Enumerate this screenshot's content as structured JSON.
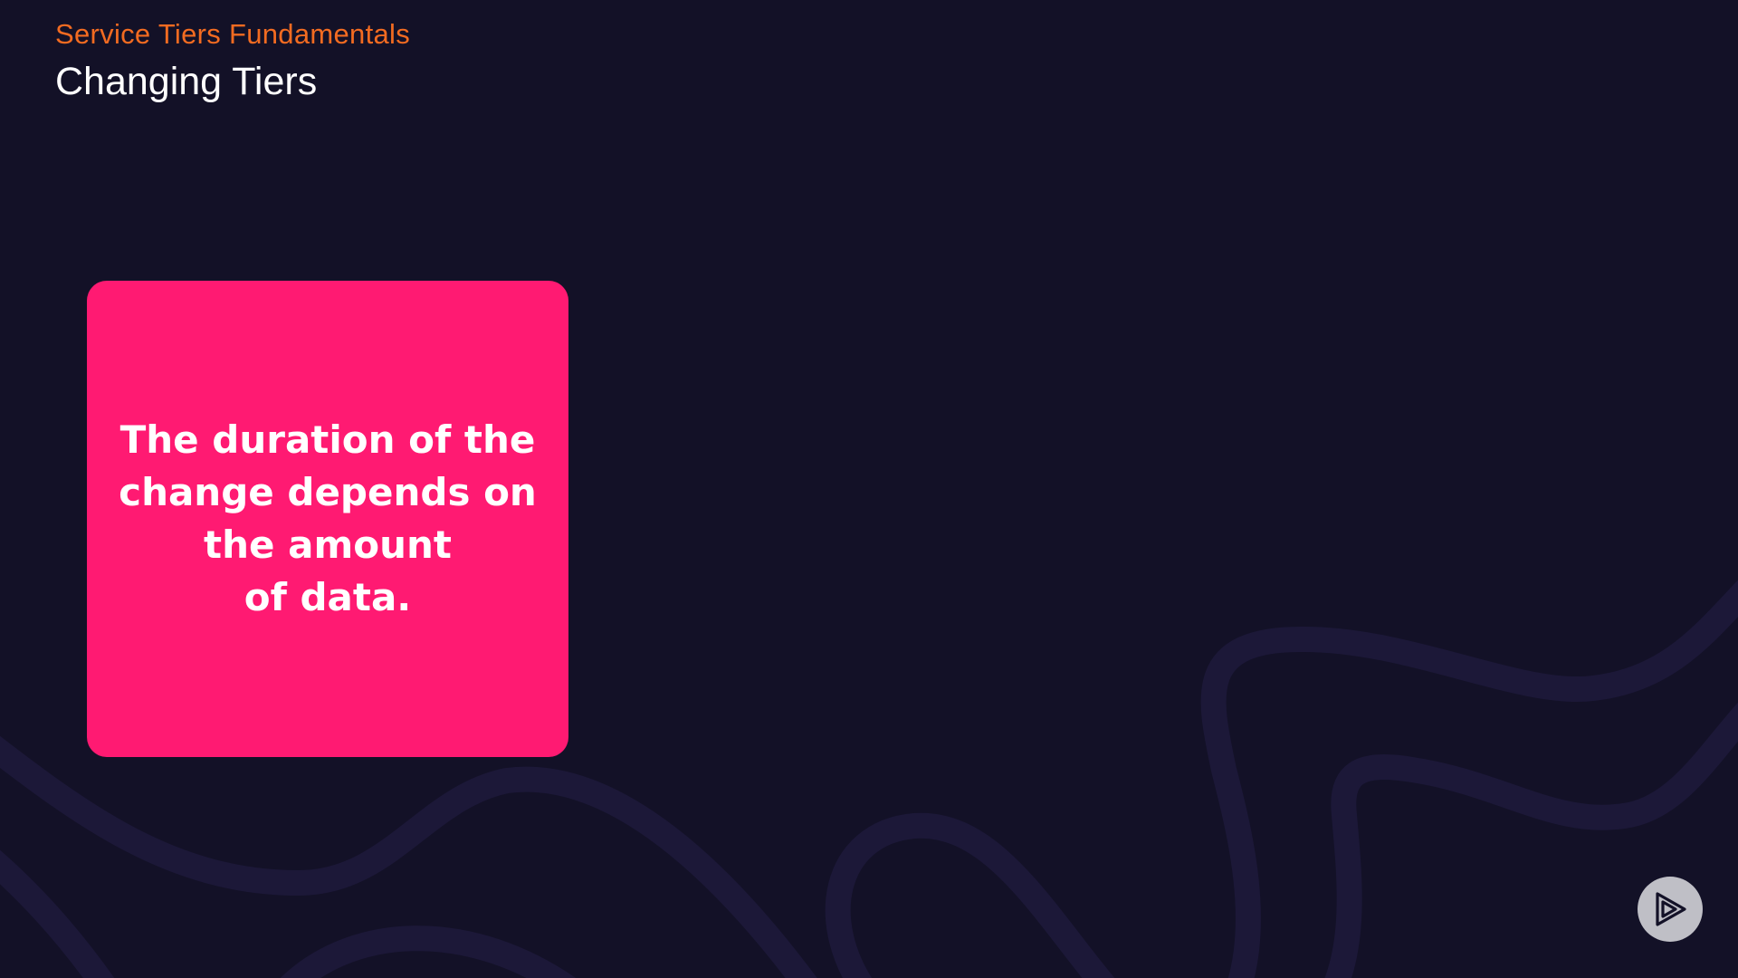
{
  "header": {
    "section_title": "Service Tiers Fundamentals",
    "page_title": "Changing Tiers"
  },
  "callout": {
    "text": "The duration of the\nchange depends on\nthe amount\nof data."
  },
  "colors": {
    "background": "#131127",
    "accent_orange": "#f26b21",
    "callout_pink": "#ff1a72",
    "wave_lines": "#1c1838"
  },
  "icons": {
    "logo": "play-logo-icon"
  }
}
